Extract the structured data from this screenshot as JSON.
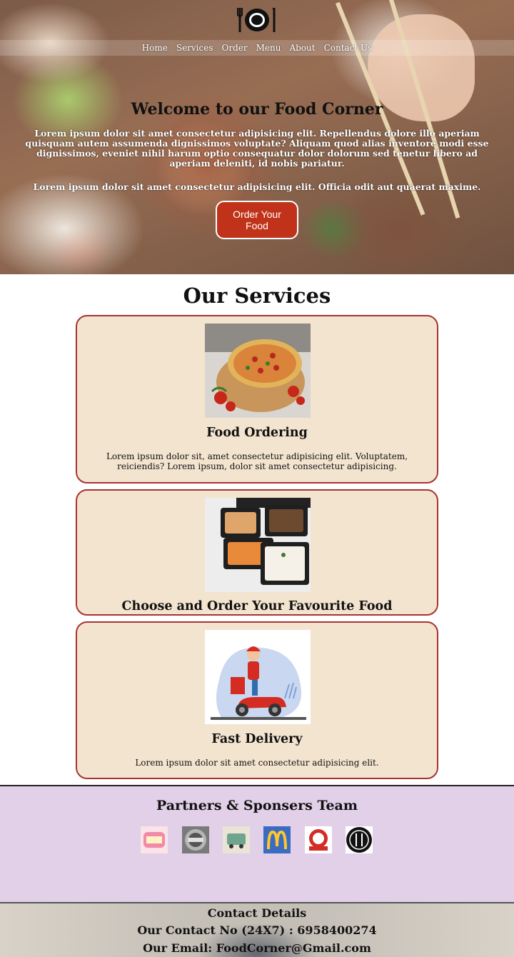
{
  "nav": {
    "links": [
      "Home",
      "Services",
      "Order",
      "Menu",
      "About",
      "Contact Us"
    ]
  },
  "hero": {
    "title": "Welcome to our Food Corner",
    "paragraph1": "Lorem ipsum dolor sit amet consectetur adipisicing elit. Repellendus dolore illo aperiam quisquam autem assumenda dignissimos voluptate? Aliquam quod alias inventore modi esse dignissimos, eveniet nihil harum optio consequatur dolor dolorum sed tenetur libero ad aperiam deleniti, id nobis pariatur.",
    "paragraph2": "Lorem ipsum dolor sit amet consectetur adipisicing elit. Officia odit aut quaerat maxime.",
    "button_label": "Order Your Food"
  },
  "services": {
    "title": "Our Services",
    "cards": [
      {
        "title": "Food Ordering",
        "description": "Lorem ipsum dolor sit, amet consectetur adipisicing elit. Voluptatem, reiciendis? Lorem ipsum, dolor sit amet consectetur adipisicing.",
        "image_icon": "pizza-image"
      },
      {
        "title": "Choose and Order Your Favourite Food",
        "description": "",
        "image_icon": "meal-boxes-image"
      },
      {
        "title": "Fast Delivery",
        "description": "Lorem ipsum dolor sit amet consectetur adipisicing elit.",
        "image_icon": "delivery-scooter-image"
      }
    ]
  },
  "partners": {
    "title": "Partners & Sponsers Team",
    "logos": [
      "sweet-food-logo",
      "hard-rock-cafe-logo",
      "food-truck-logo",
      "mcdonalds-logo",
      "red-restaurant-logo",
      "black-fork-knife-logo"
    ]
  },
  "contact": {
    "title": "Contact Details",
    "phone_line": "Our Contact No (24X7) : 6958400274",
    "email_line": "Our Email: FoodCorner@Gmail.com"
  },
  "colors": {
    "card_bg": "#f3e4cf",
    "card_border": "#a83232",
    "button_bg": "#c0321a",
    "partners_bg": "#e2cfe8"
  }
}
